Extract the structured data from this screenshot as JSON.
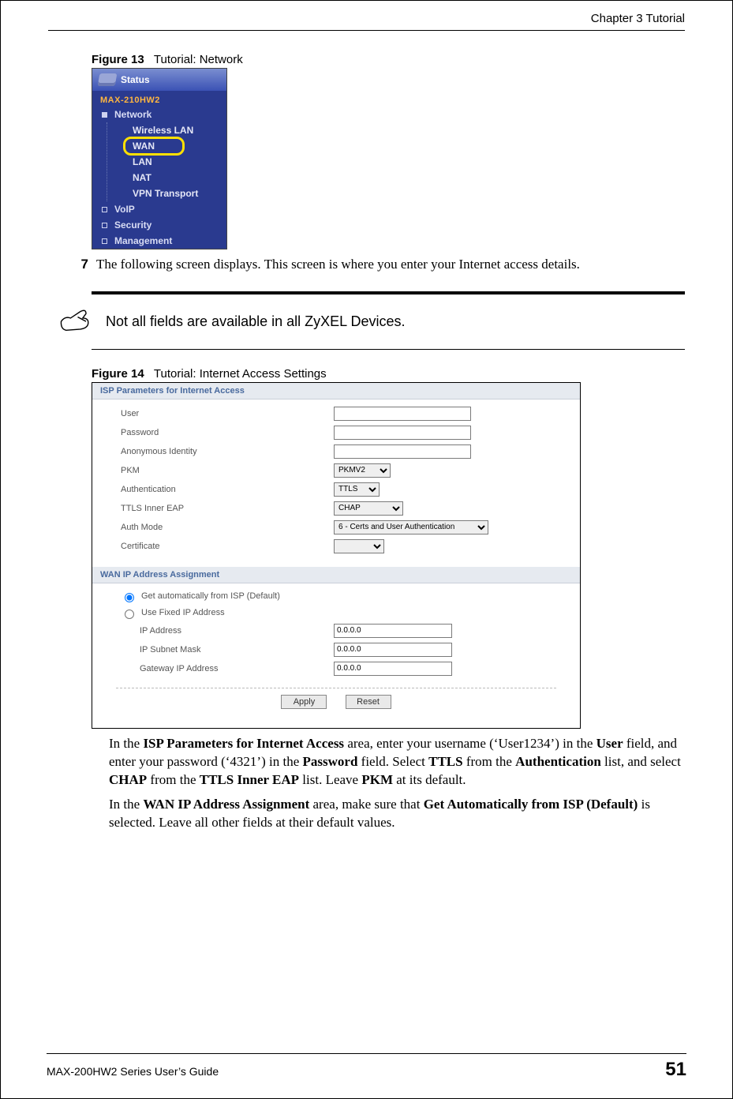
{
  "header": {
    "chapter": "Chapter 3 Tutorial"
  },
  "fig13": {
    "label": "Figure 13",
    "title": "Tutorial: Network",
    "status_label": "Status",
    "device_name": "MAX-210HW2",
    "nav": {
      "network": "Network",
      "sub": {
        "wlan": "Wireless LAN",
        "wan": "WAN",
        "lan": "LAN",
        "nat": "NAT",
        "vpn": "VPN Transport"
      },
      "voip": "VoIP",
      "security": "Security",
      "management": "Management"
    }
  },
  "step7": {
    "num": "7",
    "text": "The following screen displays. This screen is where you enter your Internet access details."
  },
  "note": {
    "text": "Not all fields are available in all ZyXEL Devices."
  },
  "fig14": {
    "label": "Figure 14",
    "title": "Tutorial: Internet Access Settings",
    "section_isp": "ISP Parameters for Internet Access",
    "section_wan": "WAN IP Address Assignment",
    "labels": {
      "user": "User",
      "password": "Password",
      "anon": "Anonymous Identity",
      "pkm": "PKM",
      "auth": "Authentication",
      "ttls_inner": "TTLS Inner EAP",
      "auth_mode": "Auth Mode",
      "cert": "Certificate",
      "get_auto": "Get automatically from ISP (Default)",
      "use_fixed": "Use Fixed IP Address",
      "ip_addr": "IP Address",
      "subnet": "IP Subnet Mask",
      "gateway": "Gateway IP Address"
    },
    "values": {
      "user": "",
      "password": "",
      "anon": "",
      "pkm": "PKMV2",
      "auth": "TTLS",
      "ttls_inner": "CHAP",
      "auth_mode": "6 - Certs and User Authentication",
      "cert": "",
      "ip_addr": "0.0.0.0",
      "subnet": "0.0.0.0",
      "gateway": "0.0.0.0"
    },
    "buttons": {
      "apply": "Apply",
      "reset": "Reset"
    }
  },
  "para1": {
    "t1": "In the ",
    "b1": "ISP Parameters for Internet Access",
    "t2": " area, enter your username (‘User1234’) in the ",
    "b2": "User",
    "t3": " field, and enter your password (‘4321’) in the ",
    "b3": "Password",
    "t4": " field. Select ",
    "b4": "TTLS",
    "t5": " from the ",
    "b5": "Authentication",
    "t6": " list, and select ",
    "b6": "CHAP",
    "t7": " from the ",
    "b7": "TTLS Inner EAP",
    "t8": " list. Leave ",
    "b8": "PKM",
    "t9": " at its default."
  },
  "para2": {
    "t1": "In the ",
    "b1": "WAN IP Address Assignment",
    "t2": " area, make sure that ",
    "b2": "Get Automatically from ISP (Default)",
    "t3": " is selected. Leave all other fields at their default values."
  },
  "footer": {
    "left": "MAX-200HW2 Series User’s Guide",
    "right": "51"
  }
}
